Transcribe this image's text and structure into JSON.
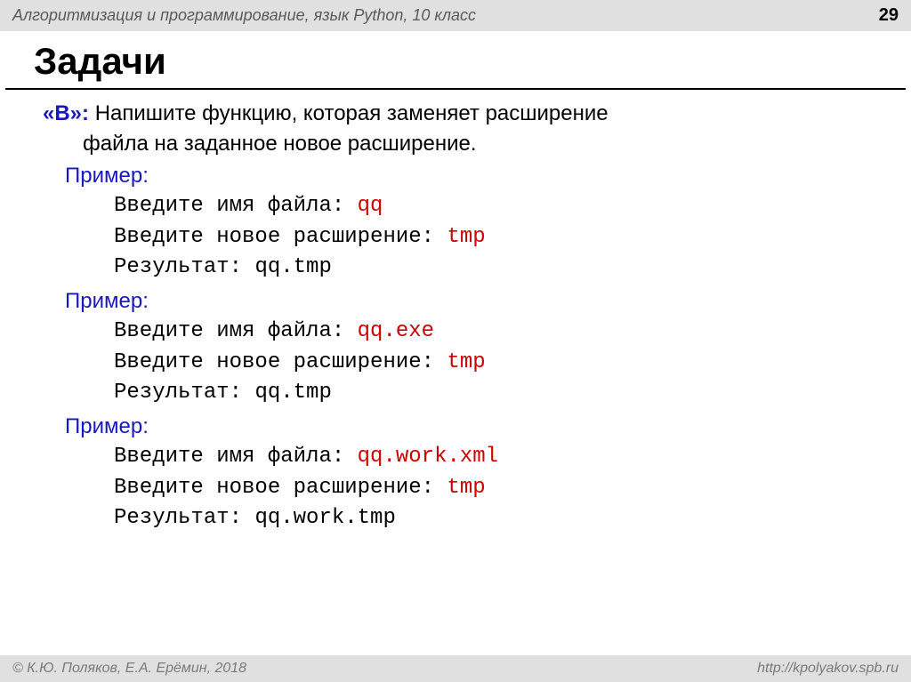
{
  "header": {
    "subject": "Алгоритмизация и программирование, язык Python, 10 класс",
    "page": "29"
  },
  "title": "Задачи",
  "task": {
    "label": "«B»:",
    "desc_line1": " Напишите функцию, которая заменяет расширение",
    "desc_line2": "файла на заданное новое расширение."
  },
  "examples": [
    {
      "label": "Пример:",
      "prompt1": "Введите имя файла: ",
      "input1": "qq",
      "prompt2": "Введите новое расширение: ",
      "input2": "tmp",
      "result_label": "Результат: ",
      "result": "qq.tmp"
    },
    {
      "label": "Пример:",
      "prompt1": "Введите имя файла: ",
      "input1": "qq.exe",
      "prompt2": "Введите новое расширение: ",
      "input2": "tmp",
      "result_label": "Результат: ",
      "result": "qq.tmp"
    },
    {
      "label": "Пример:",
      "prompt1": "Введите имя файла: ",
      "input1": "qq.work.xml",
      "prompt2": "Введите новое расширение: ",
      "input2": "tmp",
      "result_label": "Результат: ",
      "result": "qq.work.tmp"
    }
  ],
  "footer": {
    "copyright": "© К.Ю. Поляков, Е.А. Ерёмин, 2018",
    "url": "http://kpolyakov.spb.ru"
  }
}
